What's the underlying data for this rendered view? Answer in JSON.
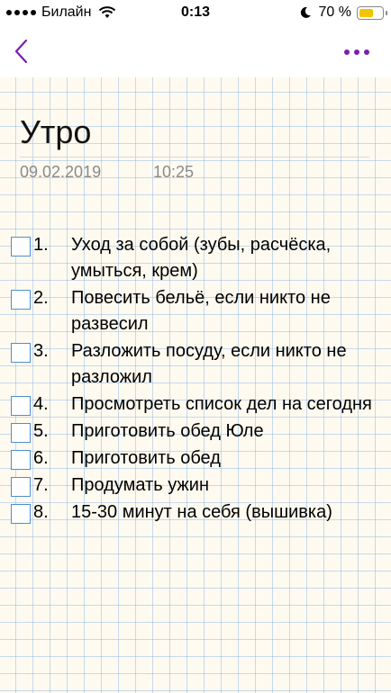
{
  "status": {
    "carrier": "Билайн",
    "time": "0:13",
    "battery_pct": "70 %",
    "battery_level": 0.7,
    "colors": {
      "battery": "#f5c400"
    }
  },
  "nav": {
    "back_icon": "chevron-left-icon",
    "more_icon": "more-dots-icon",
    "accent": "#7a1fb0"
  },
  "note": {
    "title": "Утро",
    "date": "09.02.2019",
    "time": "10:25",
    "items": [
      {
        "num": "1.",
        "text": "Уход за собой (зубы, расчёска, умыться, крем)",
        "checked": false
      },
      {
        "num": "2.",
        "text": "Повесить бельё, если никто не развесил",
        "checked": false
      },
      {
        "num": "3.",
        "text": "Разложить посуду, если никто не разложил",
        "checked": false
      },
      {
        "num": "4.",
        "text": "Просмотреть список дел на сегодня",
        "checked": false
      },
      {
        "num": "5.",
        "text": "Приготовить обед Юле",
        "checked": false
      },
      {
        "num": "6.",
        "text": "Приготовить обед",
        "checked": false
      },
      {
        "num": "7.",
        "text": "Продумать ужин",
        "checked": false
      },
      {
        "num": "8.",
        "text": "15-30 минут на себя (вышивка)",
        "checked": false
      }
    ]
  }
}
